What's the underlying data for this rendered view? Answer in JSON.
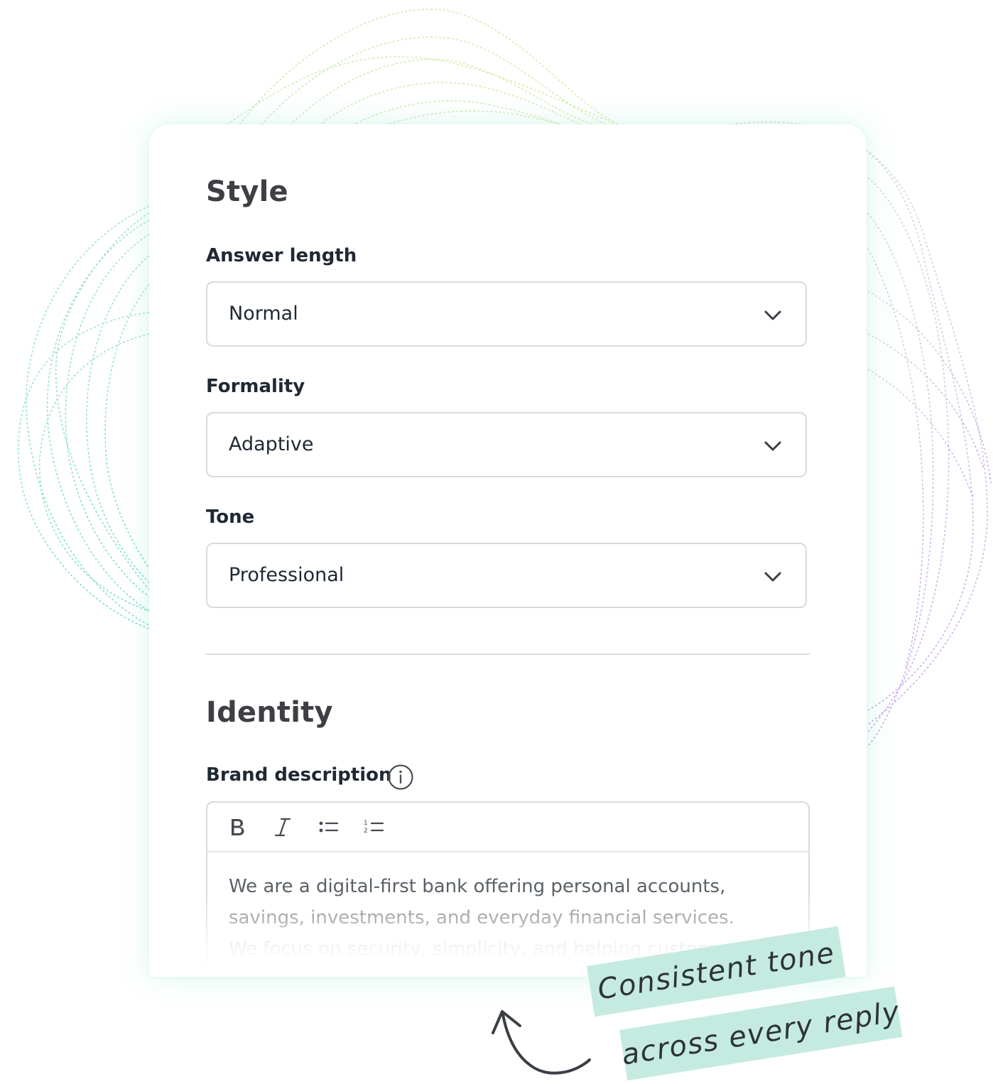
{
  "style_section": {
    "title": "Style",
    "answer_length": {
      "label": "Answer length",
      "value": "Normal"
    },
    "formality": {
      "label": "Formality",
      "value": "Adaptive"
    },
    "tone": {
      "label": "Tone",
      "value": "Professional"
    }
  },
  "identity_section": {
    "title": "Identity",
    "brand_description": {
      "label": "Brand description",
      "toolbar": [
        "bold-icon",
        "italic-icon",
        "bulleted-list-icon",
        "numbered-list-icon"
      ],
      "text_lines": [
        "We are a digital-first bank offering personal accounts,",
        "savings, investments, and everyday financial services.",
        "We focus on security, simplicity, and helping customers"
      ]
    }
  },
  "annotation": {
    "line1": "Consistent tone",
    "line2": "across every reply"
  },
  "colors": {
    "accent_tape": "#c5ebe1",
    "text_dark": "#1f2833",
    "border": "#d9dadd",
    "wave_green": "#9ad6b0",
    "wave_purple": "#c9a6e8"
  }
}
